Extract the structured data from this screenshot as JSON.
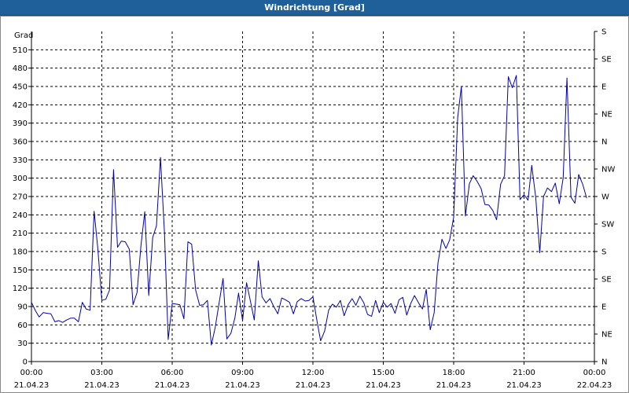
{
  "window": {
    "title": "Windrichtung [Grad]"
  },
  "chart_data": {
    "type": "line",
    "title": "Windrichtung [Grad]",
    "ylabel": "Grad",
    "xlabel": "",
    "ylim": [
      0,
      540
    ],
    "xlim": [
      "21.04.23 00:00",
      "22.04.23 00:00"
    ],
    "grid": true,
    "yticks": [
      0,
      30,
      60,
      90,
      120,
      150,
      180,
      210,
      240,
      270,
      300,
      330,
      360,
      390,
      420,
      450,
      480,
      510
    ],
    "right_axis_labels": [
      {
        "value": 0,
        "label": "N"
      },
      {
        "value": 45,
        "label": "NE"
      },
      {
        "value": 90,
        "label": "E"
      },
      {
        "value": 135,
        "label": "SE"
      },
      {
        "value": 180,
        "label": "S"
      },
      {
        "value": 225,
        "label": "SW"
      },
      {
        "value": 270,
        "label": "W"
      },
      {
        "value": 315,
        "label": "NW"
      },
      {
        "value": 360,
        "label": "N"
      },
      {
        "value": 405,
        "label": "NE"
      },
      {
        "value": 450,
        "label": "E"
      },
      {
        "value": 495,
        "label": "SE"
      },
      {
        "value": 540,
        "label": "S"
      }
    ],
    "xticks": [
      {
        "hour": 0,
        "time": "00:00",
        "date": "21.04.23"
      },
      {
        "hour": 3,
        "time": "03:00",
        "date": "21.04.23"
      },
      {
        "hour": 6,
        "time": "06:00",
        "date": "21.04.23"
      },
      {
        "hour": 9,
        "time": "09:00",
        "date": "21.04.23"
      },
      {
        "hour": 12,
        "time": "12:00",
        "date": "21.04.23"
      },
      {
        "hour": 15,
        "time": "15:00",
        "date": "21.04.23"
      },
      {
        "hour": 18,
        "time": "18:00",
        "date": "21.04.23"
      },
      {
        "hour": 21,
        "time": "21:00",
        "date": "21.04.23"
      },
      {
        "hour": 24,
        "time": "00:00",
        "date": "22.04.23"
      }
    ],
    "series": [
      {
        "color": "#0000b0",
        "hours": [
          0,
          0.17,
          0.33,
          0.5,
          0.67,
          0.83,
          1.0,
          1.17,
          1.33,
          1.5,
          1.67,
          1.83,
          2.0,
          2.17,
          2.33,
          2.5,
          2.67,
          2.83,
          3.0,
          3.17,
          3.33,
          3.5,
          3.67,
          3.83,
          4.0,
          4.17,
          4.33,
          4.5,
          4.67,
          4.83,
          5.0,
          5.17,
          5.33,
          5.5,
          5.67,
          5.83,
          6.0,
          6.17,
          6.33,
          6.5,
          6.67,
          6.83,
          7.0,
          7.17,
          7.33,
          7.5,
          7.67,
          7.83,
          8.0,
          8.17,
          8.33,
          8.5,
          8.67,
          8.83,
          9.0,
          9.17,
          9.33,
          9.5,
          9.67,
          9.83,
          10.0,
          10.17,
          10.33,
          10.5,
          10.67,
          10.83,
          11.0,
          11.17,
          11.33,
          11.5,
          11.67,
          11.83,
          12.0,
          12.17,
          12.33,
          12.5,
          12.67,
          12.83,
          13.0,
          13.17,
          13.33,
          13.5,
          13.67,
          13.83,
          14.0,
          14.17,
          14.33,
          14.5,
          14.67,
          14.83,
          15.0,
          15.17,
          15.33,
          15.5,
          15.67,
          15.83,
          16.0,
          16.17,
          16.33,
          16.5,
          16.67,
          16.83,
          17.0,
          17.17,
          17.33,
          17.5,
          17.67,
          17.83,
          18.0,
          18.17,
          18.33,
          18.5,
          18.67,
          18.83,
          19.0,
          19.17,
          19.33,
          19.5,
          19.67,
          19.83,
          20.0,
          20.17,
          20.33,
          20.5,
          20.67,
          20.83,
          21.0,
          21.17,
          21.33,
          21.5,
          21.67,
          21.83,
          22.0,
          22.17,
          22.33,
          22.5,
          22.67,
          22.83,
          23.0,
          23.17,
          23.33,
          23.5,
          23.67,
          23.83
        ],
        "values": [
          97,
          83,
          73,
          80,
          79,
          78,
          65,
          67,
          64,
          68,
          71,
          71,
          65,
          97,
          86,
          84,
          246,
          185,
          100,
          102,
          117,
          314,
          187,
          197,
          196,
          184,
          93,
          113,
          190,
          245,
          108,
          203,
          222,
          334,
          210,
          36,
          95,
          94,
          93,
          70,
          196,
          192,
          117,
          92,
          93,
          100,
          27,
          55,
          96,
          136,
          37,
          46,
          71,
          112,
          67,
          129,
          100,
          68,
          165,
          106,
          96,
          103,
          90,
          78,
          104,
          101,
          97,
          78,
          98,
          103,
          99,
          100,
          106,
          67,
          34,
          50,
          84,
          94,
          89,
          100,
          75,
          93,
          103,
          92,
          107,
          96,
          77,
          74,
          100,
          80,
          97,
          89,
          95,
          79,
          101,
          105,
          76,
          95,
          108,
          96,
          86,
          118,
          52,
          80,
          161,
          200,
          185,
          199,
          236,
          399,
          450,
          238,
          291,
          304,
          295,
          283,
          257,
          256,
          247,
          232,
          290,
          304,
          466,
          448,
          468,
          265,
          273,
          264,
          321,
          268,
          178,
          270,
          284,
          278,
          292,
          258,
          301,
          464,
          269,
          259,
          306,
          290,
          267
        ]
      }
    ]
  }
}
